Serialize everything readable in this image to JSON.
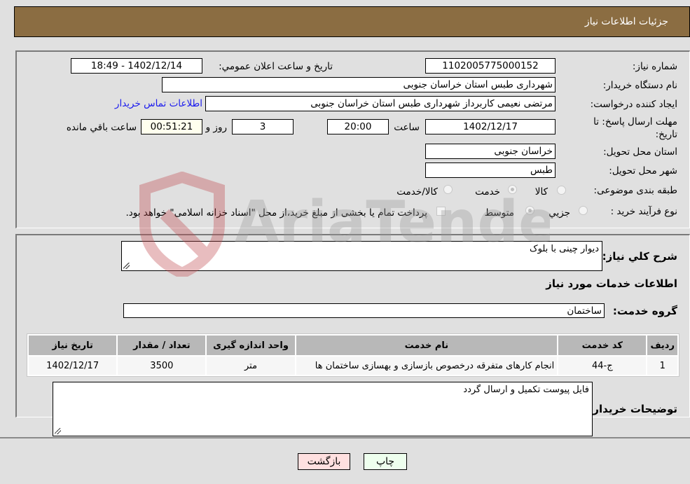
{
  "header": {
    "title": "جزئیات اطلاعات نیاز"
  },
  "details": {
    "need_number": {
      "label": "شماره نیاز:",
      "value": "1102005775000152"
    },
    "announce_datetime": {
      "label": "تاریخ و ساعت اعلان عمومي:",
      "value": "1402/12/14 - 18:49"
    },
    "buyer_org": {
      "label": "نام دستگاه خریدار:",
      "value": "شهرداری طبس استان خراسان جنوبی"
    },
    "requester": {
      "label": "ایجاد کننده درخواست:",
      "value": "مرتضی نعیمی کاربرداز شهرداری طبس استان خراسان جنوبی"
    },
    "buyer_contact_link": "اطلاعات تماس خریدار",
    "deadline": {
      "label": "مهلت ارسال پاسخ: تا تاریخ:",
      "date": "1402/12/17",
      "time_label": "ساعت",
      "time": "20:00",
      "days": "3",
      "days_label": "روز و",
      "remaining": "00:51:21",
      "remaining_label": "ساعت باقي مانده"
    },
    "delivery_province": {
      "label": "استان محل تحویل:",
      "value": "خراسان جنوبی"
    },
    "delivery_city": {
      "label": "شهر محل تحویل:",
      "value": "طبس"
    },
    "category": {
      "label": "طبقه بندی موضوعی:",
      "options": [
        "کالا",
        "خدمت",
        "کالا/خدمت"
      ],
      "selected": "خدمت"
    },
    "purchase_type": {
      "label": "نوع فرآیند خرید :",
      "options": [
        "جزيي",
        "متوسط"
      ],
      "selected": "متوسط",
      "treasury_note": "پرداخت تمام یا بخشی از مبلغ خرید،از محل \"اسناد خزانه اسلامی\" خواهد بود."
    }
  },
  "summary": {
    "description_label": "شرح کلي نیاز:",
    "description": "دیوار چینی با بلوک",
    "services_heading": "اطلاعات خدمات مورد نیاز",
    "service_group_label": "گروه خدمت:",
    "service_group": "ساختمان"
  },
  "table": {
    "headers": [
      "ردیف",
      "کد خدمت",
      "نام خدمت",
      "واحد اندازه گیری",
      "تعداد / مقدار",
      "تاریخ نیاز"
    ],
    "rows": [
      [
        "1",
        "ج-44",
        "انجام کارهای متفرقه درخصوص بازسازی و بهسازی ساختمان ها",
        "متر",
        "3500",
        "1402/12/17"
      ]
    ]
  },
  "buyer_notes": {
    "label": "توضیحات خریدار:",
    "value": "فایل پیوست تکمیل و ارسال گردد"
  },
  "buttons": {
    "print": "چاپ",
    "back": "بازگشت"
  },
  "watermark": {
    "text": "AriaTender.neT"
  }
}
